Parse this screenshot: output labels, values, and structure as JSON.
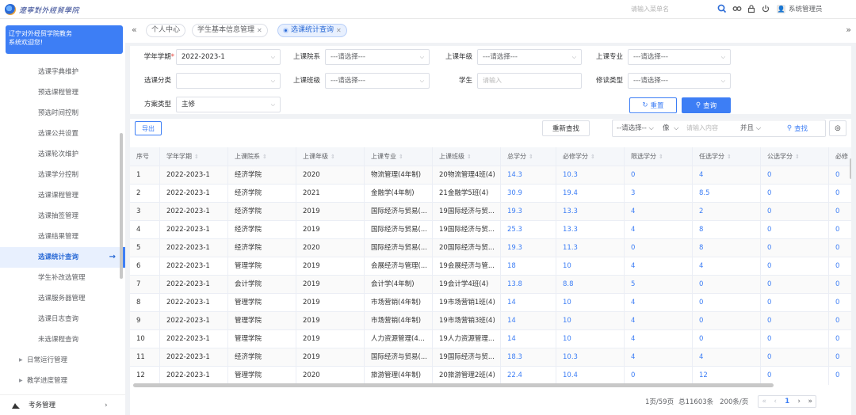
{
  "header": {
    "logo_text": "遼寧對外經貿學院",
    "search_placeholder": "请输入菜单名",
    "user_name": "系统管理员"
  },
  "sidebar": {
    "welcome_line1": "辽宁对外经贸学院教务",
    "welcome_line2": "系统欢迎您!",
    "items": [
      {
        "label": "选课字典维护"
      },
      {
        "label": "预选课程管理"
      },
      {
        "label": "预选时间控制"
      },
      {
        "label": "选课公共设置"
      },
      {
        "label": "选课轮次维护"
      },
      {
        "label": "选课学分控制"
      },
      {
        "label": "选课课程管理"
      },
      {
        "label": "选课抽签管理"
      },
      {
        "label": "选课结果管理"
      },
      {
        "label": "选课统计查询",
        "active": true
      },
      {
        "label": "学生补改选管理"
      },
      {
        "label": "选课服务器管理"
      },
      {
        "label": "选课日志查询"
      },
      {
        "label": "未选课程查询"
      }
    ],
    "groups": [
      {
        "label": "日常运行管理"
      },
      {
        "label": "教学进度管理"
      }
    ],
    "bottom_label": "考务管理"
  },
  "tabs": [
    {
      "label": "个人中心"
    },
    {
      "label": "学生基本信息管理"
    },
    {
      "label": "选课统计查询",
      "active": true
    }
  ],
  "filters": {
    "year_label": "学年学期",
    "year_value": "2022-2023-1",
    "college_label": "上课院系",
    "grade_label": "上课年级",
    "major_label": "上课专业",
    "category_label": "选课分类",
    "class_label": "上课班级",
    "student_label": "学生",
    "student_placeholder": "请输入",
    "study_type_label": "修读类型",
    "plan_label": "方案类型",
    "plan_value": "主修",
    "select_placeholder": "---请选择---"
  },
  "buttons": {
    "reset": "重置",
    "query": "查询",
    "export": "导出",
    "re_search": "重新查找",
    "find": "查找"
  },
  "toolbar": {
    "field_placeholder": "--请选择--",
    "op_value": "像",
    "input_placeholder": "请输入内容",
    "logic_value": "并且"
  },
  "table": {
    "columns": [
      "序号",
      "学年学期",
      "上课院系",
      "上课年级",
      "上课专业",
      "上课班级",
      "总学分",
      "必修学分",
      "限选学分",
      "任选学分",
      "公选学分",
      "必修"
    ],
    "rows": [
      [
        "1",
        "2022-2023-1",
        "经济学院",
        "2020",
        "物流管理(4年制)",
        "20物流管理4班(4)",
        "14.3",
        "10.3",
        "0",
        "4",
        "0",
        "0"
      ],
      [
        "2",
        "2022-2023-1",
        "经济学院",
        "2021",
        "金融学(4年制)",
        "21金融学5班(4)",
        "30.9",
        "19.4",
        "3",
        "8.5",
        "0",
        "0"
      ],
      [
        "3",
        "2022-2023-1",
        "经济学院",
        "2019",
        "国际经济与贸易(...",
        "19国际经济与贸...",
        "19.3",
        "13.3",
        "4",
        "2",
        "0",
        "0"
      ],
      [
        "4",
        "2022-2023-1",
        "经济学院",
        "2019",
        "国际经济与贸易(...",
        "19国际经济与贸...",
        "25.3",
        "13.3",
        "4",
        "8",
        "0",
        "0"
      ],
      [
        "5",
        "2022-2023-1",
        "经济学院",
        "2020",
        "国际经济与贸易(...",
        "20国际经济与贸...",
        "19.3",
        "11.3",
        "0",
        "8",
        "0",
        "0"
      ],
      [
        "6",
        "2022-2023-1",
        "管理学院",
        "2019",
        "会展经济与管理(...",
        "19会展经济与管...",
        "18",
        "10",
        "4",
        "4",
        "0",
        "0"
      ],
      [
        "7",
        "2022-2023-1",
        "会计学院",
        "2019",
        "会计学(4年制)",
        "19会计学4班(4)",
        "13.8",
        "8.8",
        "5",
        "0",
        "0",
        "0"
      ],
      [
        "8",
        "2022-2023-1",
        "管理学院",
        "2019",
        "市场营销(4年制)",
        "19市场营销1班(4)",
        "14",
        "10",
        "4",
        "0",
        "0",
        "0"
      ],
      [
        "9",
        "2022-2023-1",
        "管理学院",
        "2019",
        "市场营销(4年制)",
        "19市场营销3班(4)",
        "14",
        "10",
        "4",
        "0",
        "0",
        "0"
      ],
      [
        "10",
        "2022-2023-1",
        "管理学院",
        "2019",
        "人力资源管理(4...",
        "19人力资源管理...",
        "14",
        "10",
        "4",
        "0",
        "0",
        "0"
      ],
      [
        "11",
        "2022-2023-1",
        "经济学院",
        "2019",
        "国际经济与贸易(...",
        "19国际经济与贸...",
        "18.3",
        "10.3",
        "4",
        "4",
        "0",
        "0"
      ],
      [
        "12",
        "2022-2023-1",
        "管理学院",
        "2020",
        "旅游管理(4年制)",
        "20旅游管理2班(4)",
        "22.4",
        "10.4",
        "0",
        "12",
        "0",
        "0"
      ]
    ]
  },
  "pager": {
    "page_info": "1页/59页",
    "total": "总11603条",
    "page_size": "200条/页",
    "current": "1"
  }
}
